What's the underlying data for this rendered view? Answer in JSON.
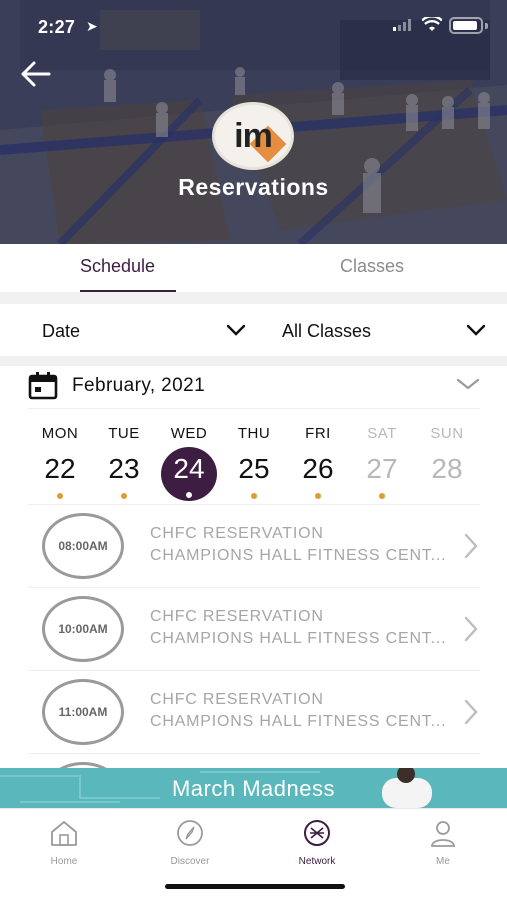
{
  "status_bar": {
    "time": "2:27"
  },
  "hero": {
    "title": "Reservations",
    "logo_text": "im"
  },
  "tabs": [
    {
      "label": "Schedule",
      "active": true
    },
    {
      "label": "Classes",
      "active": false
    }
  ],
  "filters": {
    "date_label": "Date",
    "classes_label": "All Classes"
  },
  "calendar": {
    "month": "February,  2021",
    "days": [
      {
        "name": "MON",
        "date": "22",
        "has_events": true,
        "weekend": false,
        "selected": false
      },
      {
        "name": "TUE",
        "date": "23",
        "has_events": true,
        "weekend": false,
        "selected": false
      },
      {
        "name": "WED",
        "date": "24",
        "has_events": true,
        "weekend": false,
        "selected": true
      },
      {
        "name": "THU",
        "date": "25",
        "has_events": true,
        "weekend": false,
        "selected": false
      },
      {
        "name": "FRI",
        "date": "26",
        "has_events": true,
        "weekend": false,
        "selected": false
      },
      {
        "name": "SAT",
        "date": "27",
        "has_events": true,
        "weekend": true,
        "selected": false
      },
      {
        "name": "SUN",
        "date": "28",
        "has_events": false,
        "weekend": true,
        "selected": false
      }
    ]
  },
  "reservations": [
    {
      "time": "08:00AM",
      "title": "CHFC RESERVATION",
      "location": "CHAMPIONS HALL FITNESS CENT..."
    },
    {
      "time": "10:00AM",
      "title": "CHFC RESERVATION",
      "location": "CHAMPIONS HALL FITNESS CENT..."
    },
    {
      "time": "11:00AM",
      "title": "CHFC RESERVATION",
      "location": "CHAMPIONS HALL FITNESS CENT..."
    },
    {
      "time": "",
      "title": "",
      "location": ""
    }
  ],
  "banner": {
    "text": "March Madness"
  },
  "nav": [
    {
      "label": "Home",
      "icon": "home-icon",
      "active": false
    },
    {
      "label": "Discover",
      "icon": "compass-icon",
      "active": false
    },
    {
      "label": "Network",
      "icon": "network-icon",
      "active": true
    },
    {
      "label": "Me",
      "icon": "person-icon",
      "active": false
    }
  ],
  "colors": {
    "primary": "#3d1d42",
    "dot": "#e39a3a",
    "banner": "#5ab7bb"
  }
}
